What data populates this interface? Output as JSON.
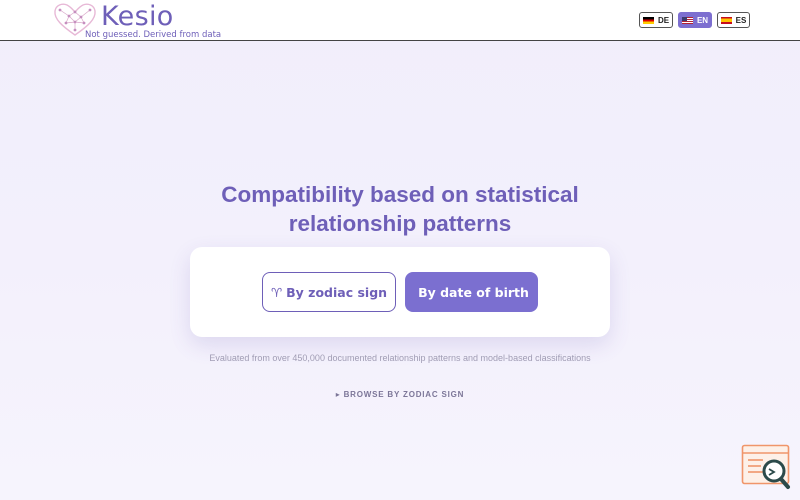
{
  "header": {
    "brand": "Kesio",
    "tagline": "Not guessed. Derived from data",
    "languages": [
      {
        "code": "DE",
        "flag": "flag-de-icon",
        "active": false
      },
      {
        "code": "EN",
        "flag": "flag-us-icon",
        "active": true
      },
      {
        "code": "ES",
        "flag": "flag-es-icon",
        "active": false
      }
    ]
  },
  "hero": {
    "title_line1": "Compatibility based on statistical",
    "title_line2": "relationship patterns"
  },
  "card": {
    "zodiac_icon": "♈",
    "zodiac_label": "By zodiac sign",
    "birth_icon": "",
    "birth_label": "By date of birth"
  },
  "info_text": "Evaluated from over 450,000 documented relationship patterns and model-based classifications",
  "browse_link": "▸ BROWSE BY ZODIAC SIGN",
  "colors": {
    "accent": "#6e5fb8",
    "primary_button": "#7b6fd0",
    "widget_orange": "#f0956a",
    "widget_teal": "#2b4a4a"
  }
}
